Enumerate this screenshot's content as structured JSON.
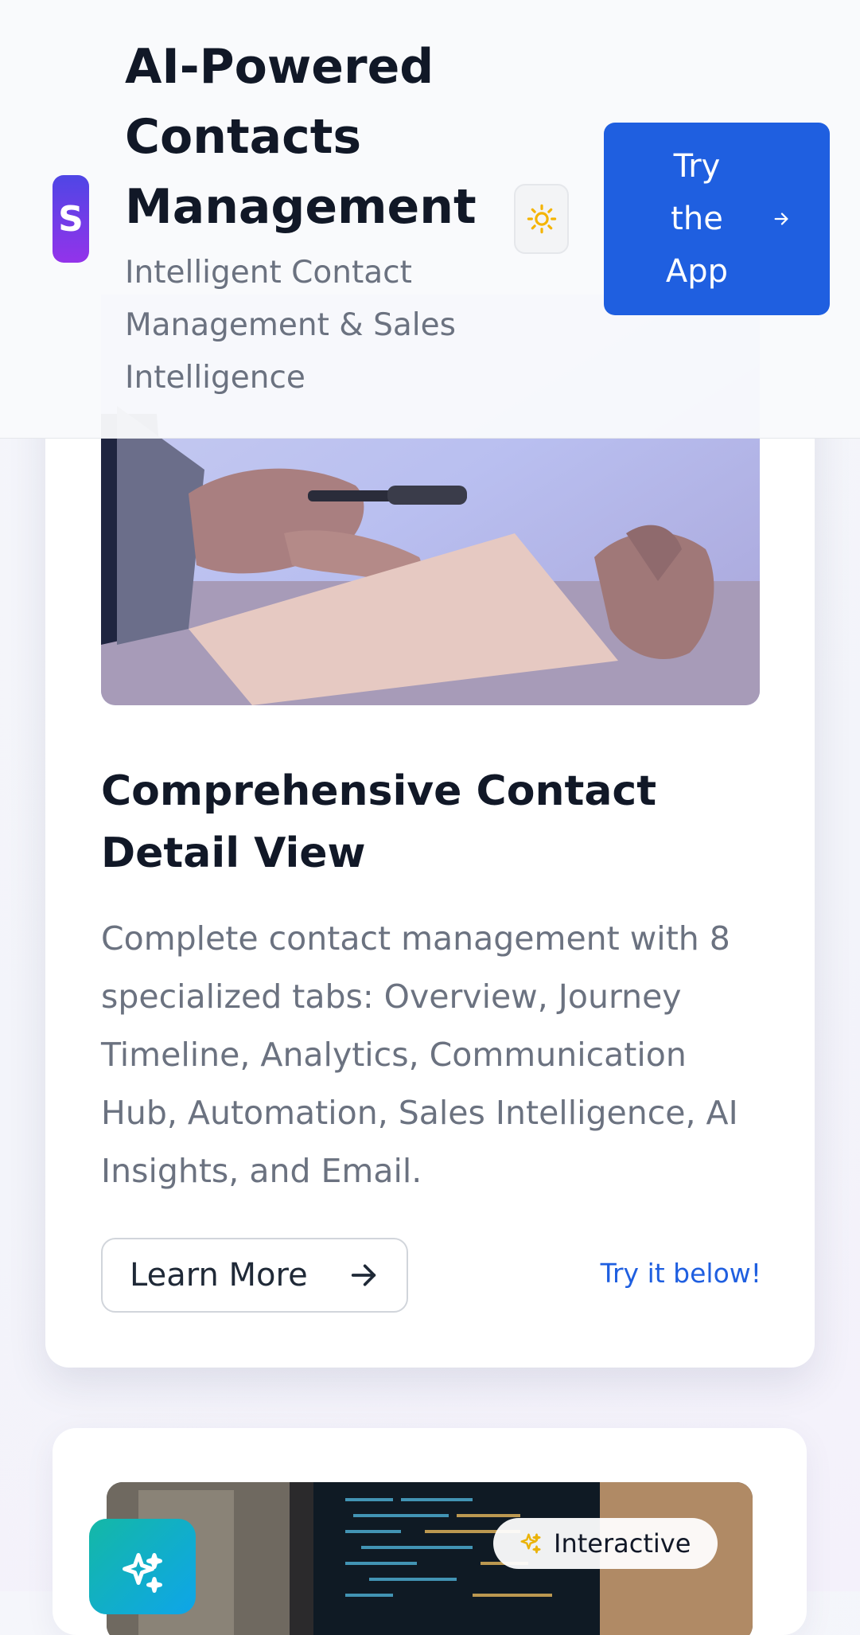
{
  "header": {
    "logo_letter": "S",
    "title": "AI-Powered Contacts Management",
    "subtitle": "Intelligent Contact Management & Sales Intelligence",
    "theme_toggle_icon": "sun-icon",
    "try_app_label": "Try the App",
    "try_app_icon": "arrow-right-icon"
  },
  "feature_card": {
    "image": "business-handshake-photo",
    "title": "Comprehensive Contact Detail View",
    "description": "Complete contact management with 8 specialized tabs: Overview, Journey Timeline, Analytics, Communication Hub, Automation, Sales Intelligence, AI Insights, and Email.",
    "learn_more_label": "Learn More",
    "learn_more_icon": "arrow-right-icon",
    "try_below_label": "Try it below!"
  },
  "next_card": {
    "image": "code-editor-photo",
    "badge_icon": "sparkles-icon",
    "pill_icon": "sparkles-icon",
    "pill_label": "Interactive"
  },
  "colors": {
    "primary": "#1f5fe0",
    "logo_gradient_start": "#4f46e5",
    "logo_gradient_end": "#9333ea",
    "sun": "#f4b400",
    "badge_teal": "#14b8a6"
  }
}
